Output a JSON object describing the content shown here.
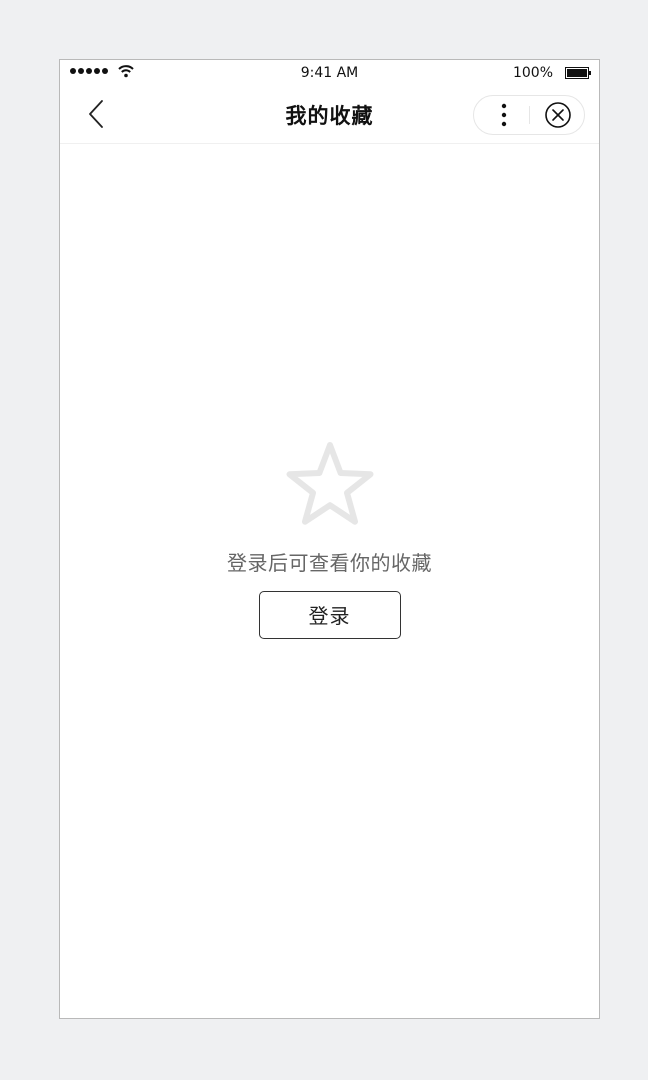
{
  "status_bar": {
    "time": "9:41 AM",
    "battery_percent": "100%",
    "signal_icon": "signal-dots-icon",
    "wifi_icon": "wifi-icon",
    "battery_icon": "battery-icon"
  },
  "nav": {
    "title": "我的收藏",
    "back_icon": "chevron-left-icon",
    "more_icon": "more-vertical-icon",
    "close_icon": "close-circle-icon"
  },
  "empty_state": {
    "icon": "star-outline-icon",
    "message": "登录后可查看你的收藏",
    "login_label": "登录"
  },
  "colors": {
    "background": "#eff0f2",
    "star": "#e6e6e6",
    "hint_text": "#666666"
  }
}
